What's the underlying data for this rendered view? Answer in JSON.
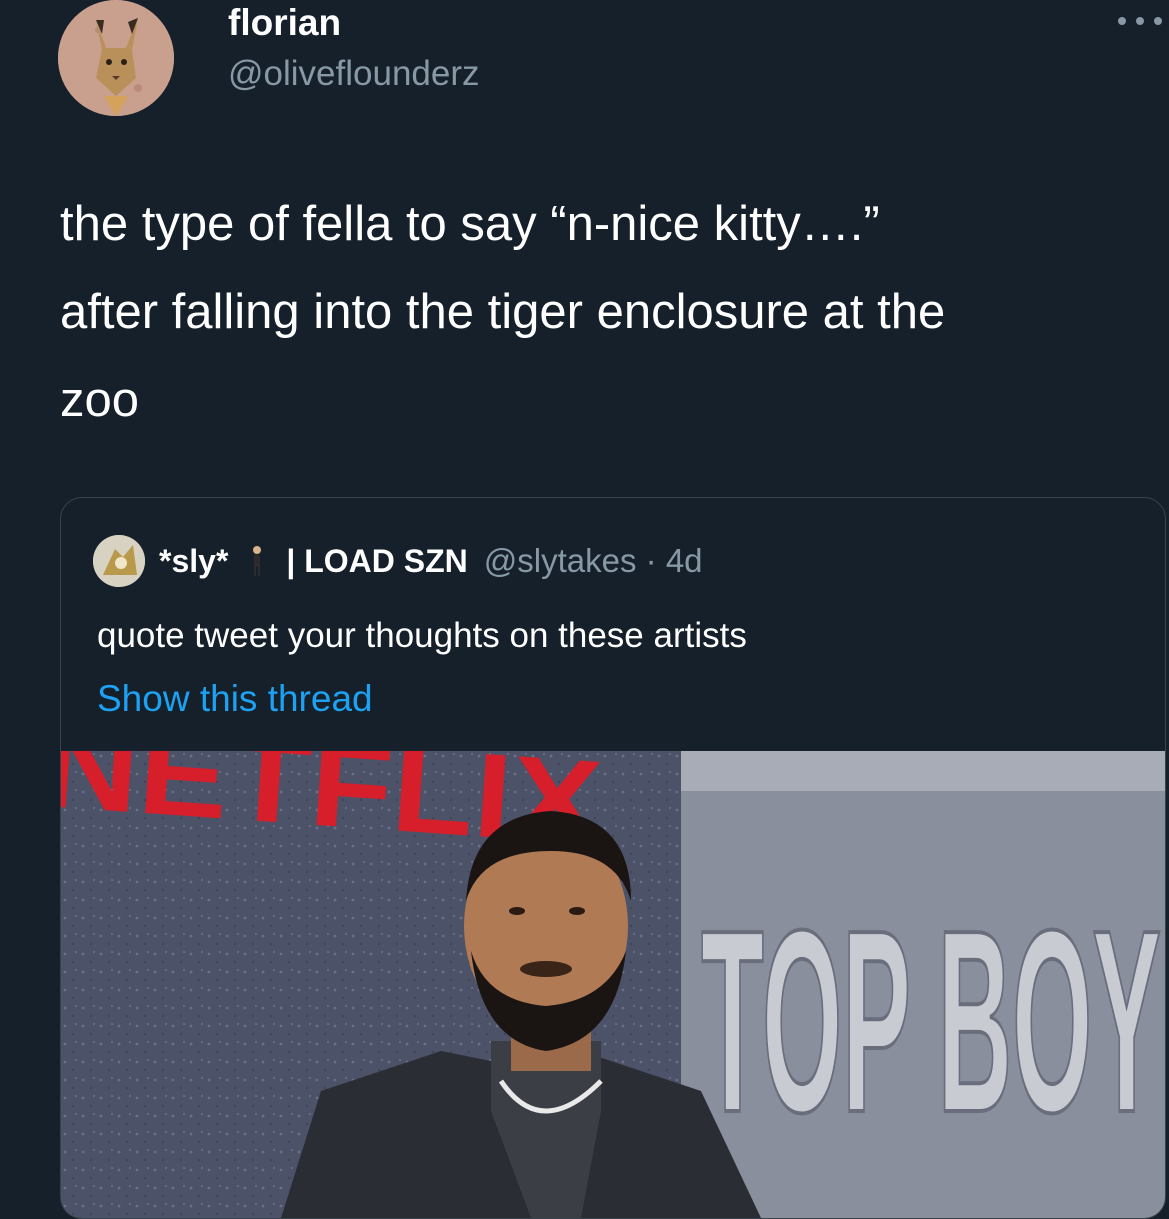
{
  "tweet": {
    "display_name": "florian",
    "handle": "@oliveflounderz",
    "text_lines": [
      "the type of fella to say “n-nice kitty….”",
      "after falling into the tiger enclosure at the",
      "zoo"
    ]
  },
  "quoted_tweet": {
    "display_name": "*sly*",
    "display_name_suffix": "| LOAD SZN",
    "handle_time": "@slytakes · 4d",
    "text": "quote tweet your thoughts on these artists",
    "thread_link": "Show this thread",
    "media": {
      "sign_left": "NETFLIX",
      "sign_right": "TOP BOY"
    }
  },
  "colors": {
    "background": "#15202b",
    "secondary_text": "#8899a6",
    "link": "#1da1f2",
    "border": "#38444d",
    "netflix_red": "#d61f2b"
  },
  "icons": {
    "avatar": "caracal-avatar",
    "more": "more-dots-icon",
    "quoted_avatar": "quoted-avatar",
    "emoji": "person-emoji-icon"
  }
}
